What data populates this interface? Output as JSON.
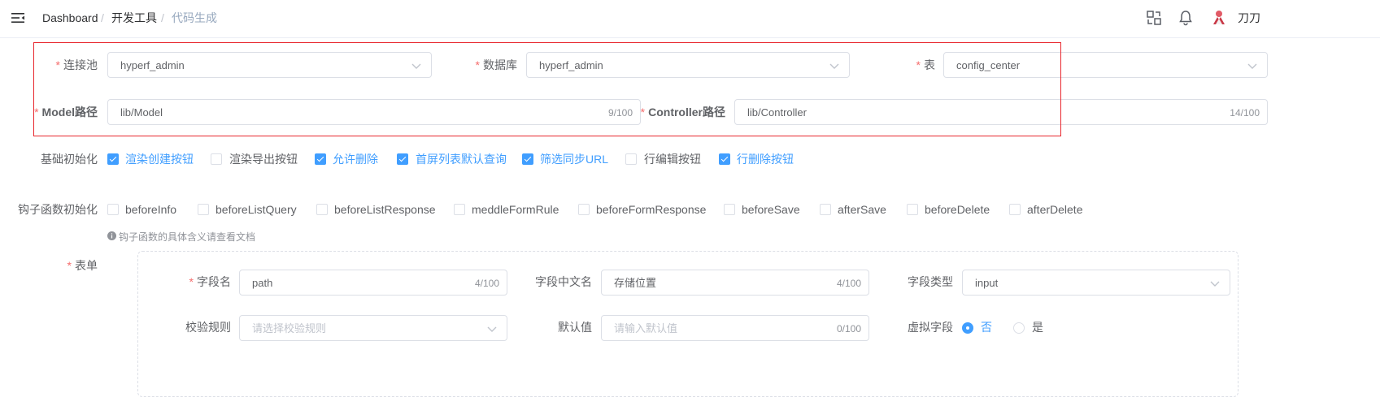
{
  "header": {
    "breadcrumb": [
      "Dashboard",
      "开发工具",
      "代码生成"
    ],
    "separator": "/",
    "user_name": "刀刀"
  },
  "form": {
    "pool": {
      "label": "连接池",
      "value": "hyperf_admin"
    },
    "database": {
      "label": "数据库",
      "value": "hyperf_admin"
    },
    "table": {
      "label": "表",
      "value": "config_center"
    },
    "model_path": {
      "label": "Model路径",
      "value": "lib/Model",
      "count": "9/100"
    },
    "controller_path": {
      "label": "Controller路径",
      "value": "lib/Controller",
      "count": "14/100"
    },
    "base_init": {
      "label": "基础初始化",
      "options": [
        {
          "label": "渲染创建按钮",
          "checked": true
        },
        {
          "label": "渲染导出按钮",
          "checked": false
        },
        {
          "label": "允许删除",
          "checked": true
        },
        {
          "label": "首屏列表默认查询",
          "checked": true
        },
        {
          "label": "筛选同步URL",
          "checked": true
        },
        {
          "label": "行编辑按钮",
          "checked": false
        },
        {
          "label": "行删除按钮",
          "checked": true
        }
      ]
    },
    "hook_init": {
      "label": "钩子函数初始化",
      "options": [
        {
          "label": "beforeInfo",
          "checked": false
        },
        {
          "label": "beforeListQuery",
          "checked": false
        },
        {
          "label": "beforeListResponse",
          "checked": false
        },
        {
          "label": "meddleFormRule",
          "checked": false
        },
        {
          "label": "beforeFormResponse",
          "checked": false
        },
        {
          "label": "beforeSave",
          "checked": false
        },
        {
          "label": "afterSave",
          "checked": false
        },
        {
          "label": "beforeDelete",
          "checked": false
        },
        {
          "label": "afterDelete",
          "checked": false
        }
      ],
      "tip": "钩子函数的具体含义请查看文档"
    },
    "form_section": {
      "label": "表单",
      "field_name": {
        "label": "字段名",
        "value": "path",
        "count": "4/100"
      },
      "field_cn_name": {
        "label": "字段中文名",
        "value": "存储位置",
        "count": "4/100"
      },
      "field_type": {
        "label": "字段类型",
        "value": "input"
      },
      "validate_rule": {
        "label": "校验规则",
        "placeholder": "请选择校验规则"
      },
      "default_value": {
        "label": "默认值",
        "placeholder": "请输入默认值",
        "count": "0/100"
      },
      "virtual_field": {
        "label": "虚拟字段",
        "options": [
          "否",
          "是"
        ],
        "selected": "否"
      }
    }
  },
  "colors": {
    "accent": "#409eff",
    "required": "#f56c6c",
    "highlight_box": "#e8262d"
  }
}
